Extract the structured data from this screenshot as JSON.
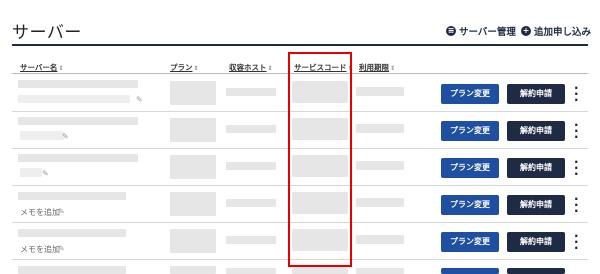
{
  "header": {
    "title": "サーバー",
    "server_manage_label": "サーバー管理",
    "add_application_label": "追加申し込み"
  },
  "table": {
    "columns": [
      "サーバー名",
      "プラン",
      "収容ホスト",
      "サービスコード",
      "利用期限"
    ],
    "sort_icon": "⇕",
    "rows": [
      {
        "memo": "",
        "plan_change_label": "プラン変更",
        "cancel_label": "解約申請"
      },
      {
        "memo": "",
        "plan_change_label": "プラン変更",
        "cancel_label": "解約申請"
      },
      {
        "memo": "",
        "plan_change_label": "プラン変更",
        "cancel_label": "解約申請"
      },
      {
        "memo": "メモを追加",
        "plan_change_label": "プラン変更",
        "cancel_label": "解約申請"
      },
      {
        "memo": "メモを追加",
        "plan_change_label": "プラン変更",
        "cancel_label": "解約申請"
      }
    ]
  },
  "colors": {
    "navy": "#1f2a44",
    "plan_button": "#1f4fa0",
    "highlight": "#e60000"
  }
}
